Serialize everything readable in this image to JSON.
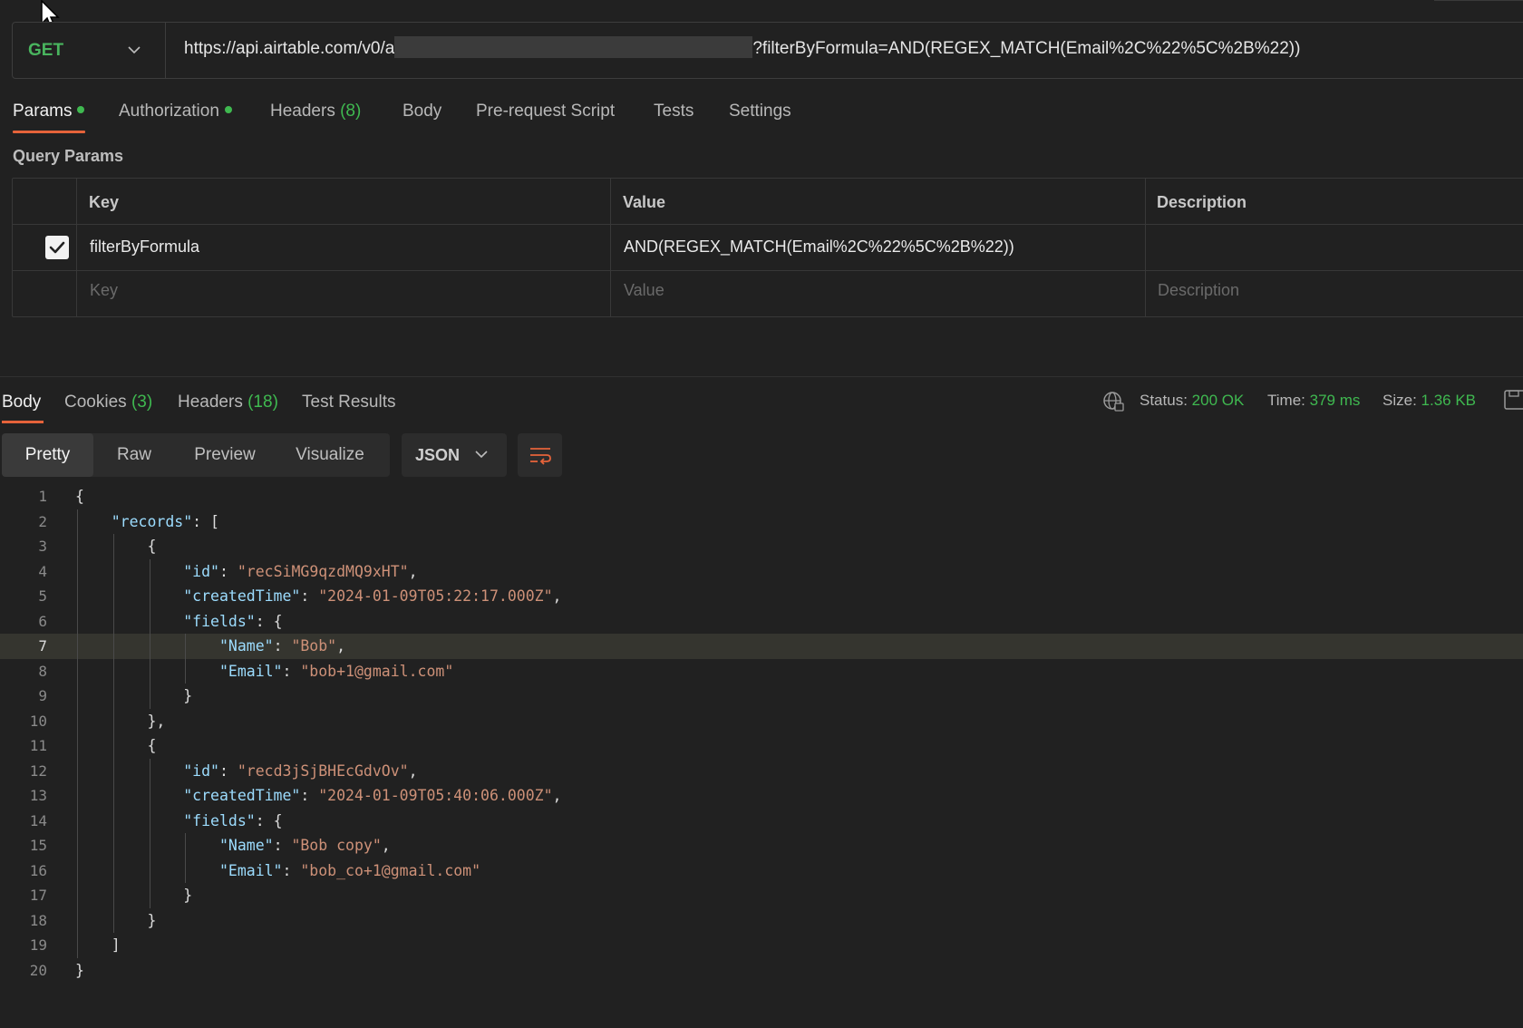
{
  "request": {
    "method": "GET",
    "url_prefix": "https://api.airtable.com/v0/a",
    "url_suffix": "?filterByFormula=AND(REGEX_MATCH(Email%2C%22%5C%2B%22))",
    "tabs": [
      {
        "label": "Params",
        "dot": true
      },
      {
        "label": "Authorization",
        "dot": true
      },
      {
        "label": "Headers",
        "count": "(8)"
      },
      {
        "label": "Body"
      },
      {
        "label": "Pre-request Script"
      },
      {
        "label": "Tests"
      },
      {
        "label": "Settings"
      }
    ]
  },
  "query_params": {
    "title": "Query Params",
    "headers": {
      "key": "Key",
      "value": "Value",
      "description": "Description"
    },
    "rows": [
      {
        "checked": true,
        "key": "filterByFormula",
        "value": "AND(REGEX_MATCH(Email%2C%22%5C%2B%22))",
        "description": ""
      }
    ],
    "placeholder": {
      "key": "Key",
      "value": "Value",
      "description": "Description"
    }
  },
  "response": {
    "tabs": [
      {
        "label": "Body"
      },
      {
        "label": "Cookies",
        "count": "(3)"
      },
      {
        "label": "Headers",
        "count": "(18)"
      },
      {
        "label": "Test Results"
      }
    ],
    "status_label": "Status:",
    "status_value": "200 OK",
    "time_label": "Time:",
    "time_value": "379 ms",
    "size_label": "Size:",
    "size_value": "1.36 KB",
    "views": [
      "Pretty",
      "Raw",
      "Preview",
      "Visualize"
    ],
    "active_view": "Pretty",
    "format": "JSON",
    "highlighted_line": 7,
    "code_lines": [
      "{",
      "    \"records\": [",
      "        {",
      "            \"id\": \"recSiMG9qzdMQ9xHT\",",
      "            \"createdTime\": \"2024-01-09T05:22:17.000Z\",",
      "            \"fields\": {",
      "                \"Name\": \"Bob\",",
      "                \"Email\": \"bob+1@gmail.com\"",
      "            }",
      "        },",
      "        {",
      "            \"id\": \"recd3jSjBHEcGdvOv\",",
      "            \"createdTime\": \"2024-01-09T05:40:06.000Z\",",
      "            \"fields\": {",
      "                \"Name\": \"Bob copy\",",
      "                \"Email\": \"bob_co+1@gmail.com\"",
      "            }",
      "        }",
      "    ]",
      "}"
    ]
  },
  "colors": {
    "background": "#212121",
    "accent": "#e5633a",
    "success": "#3fb950",
    "json_key": "#9cdcfe",
    "json_string": "#ce9178"
  },
  "icons": [
    "cursor-icon",
    "chevron-down-icon",
    "globe-icon",
    "save-icon",
    "wrap-lines-icon",
    "checkbox-icon"
  ]
}
